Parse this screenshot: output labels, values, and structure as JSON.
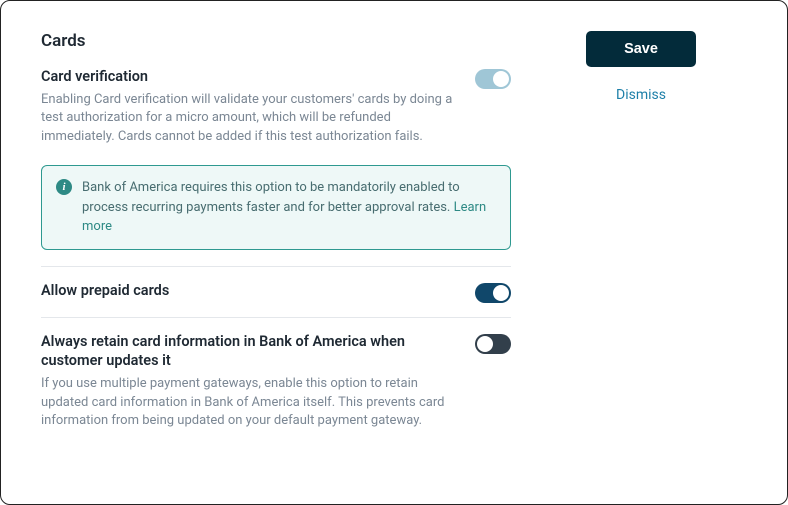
{
  "sectionTitle": "Cards",
  "settings": {
    "cardVerification": {
      "label": "Card verification",
      "desc": "Enabling Card verification will validate your customers' cards by doing a test authorization for a micro amount, which will be refunded immediately. Cards cannot be added if this test authorization fails.",
      "on": true,
      "info": {
        "text": "Bank of America requires this option to be mandatorily enabled to process recurring payments faster and for better approval rates. ",
        "linkLabel": "Learn more"
      }
    },
    "allowPrepaid": {
      "label": "Allow prepaid cards",
      "on": true
    },
    "alwaysRetain": {
      "label": "Always retain card information in Bank of America when customer updates it",
      "desc": "If you use multiple payment gateways, enable this option to retain updated card information in Bank of America itself. This prevents card information from being updated on your default payment gateway.",
      "on": false
    }
  },
  "actions": {
    "save": "Save",
    "dismiss": "Dismiss"
  }
}
